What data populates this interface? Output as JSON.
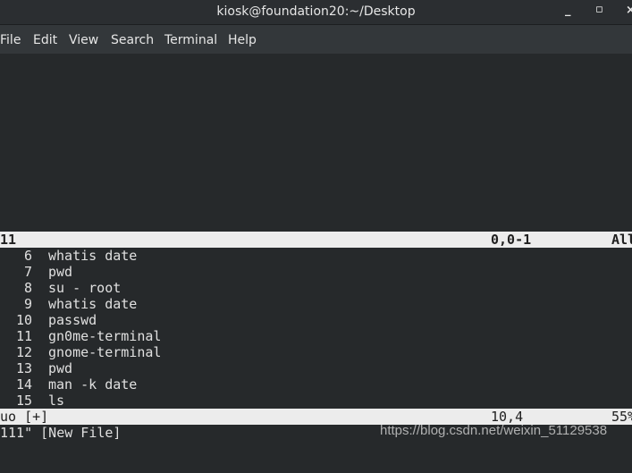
{
  "window": {
    "title": "kiosk@foundation20:~/Desktop",
    "controls": [
      "minimize",
      "maximize",
      "close"
    ]
  },
  "menu": [
    "File",
    "Edit",
    "View",
    "Search",
    "Terminal",
    "Help"
  ],
  "top_status": {
    "name": "11",
    "position": "0,0-1",
    "scroll": "All"
  },
  "lines": [
    {
      "num": "6",
      "text": "whatis date"
    },
    {
      "num": "7",
      "text": "pwd"
    },
    {
      "num": "8",
      "text": "su - root"
    },
    {
      "num": "9",
      "text": "whatis date"
    },
    {
      "num": "10",
      "text": "passwd"
    },
    {
      "num": "11",
      "text": "gn0me-terminal"
    },
    {
      "num": "12",
      "text": "gnome-terminal"
    },
    {
      "num": "13",
      "text": "pwd"
    },
    {
      "num": "14",
      "text": "man -k date"
    },
    {
      "num": "15",
      "text": "ls"
    }
  ],
  "bottom_status": {
    "name": "uo [+]",
    "position": "10,4",
    "scroll": "55%"
  },
  "command_line": "111\" [New File]",
  "watermark": "https://blog.csdn.net/weixin_51129538"
}
